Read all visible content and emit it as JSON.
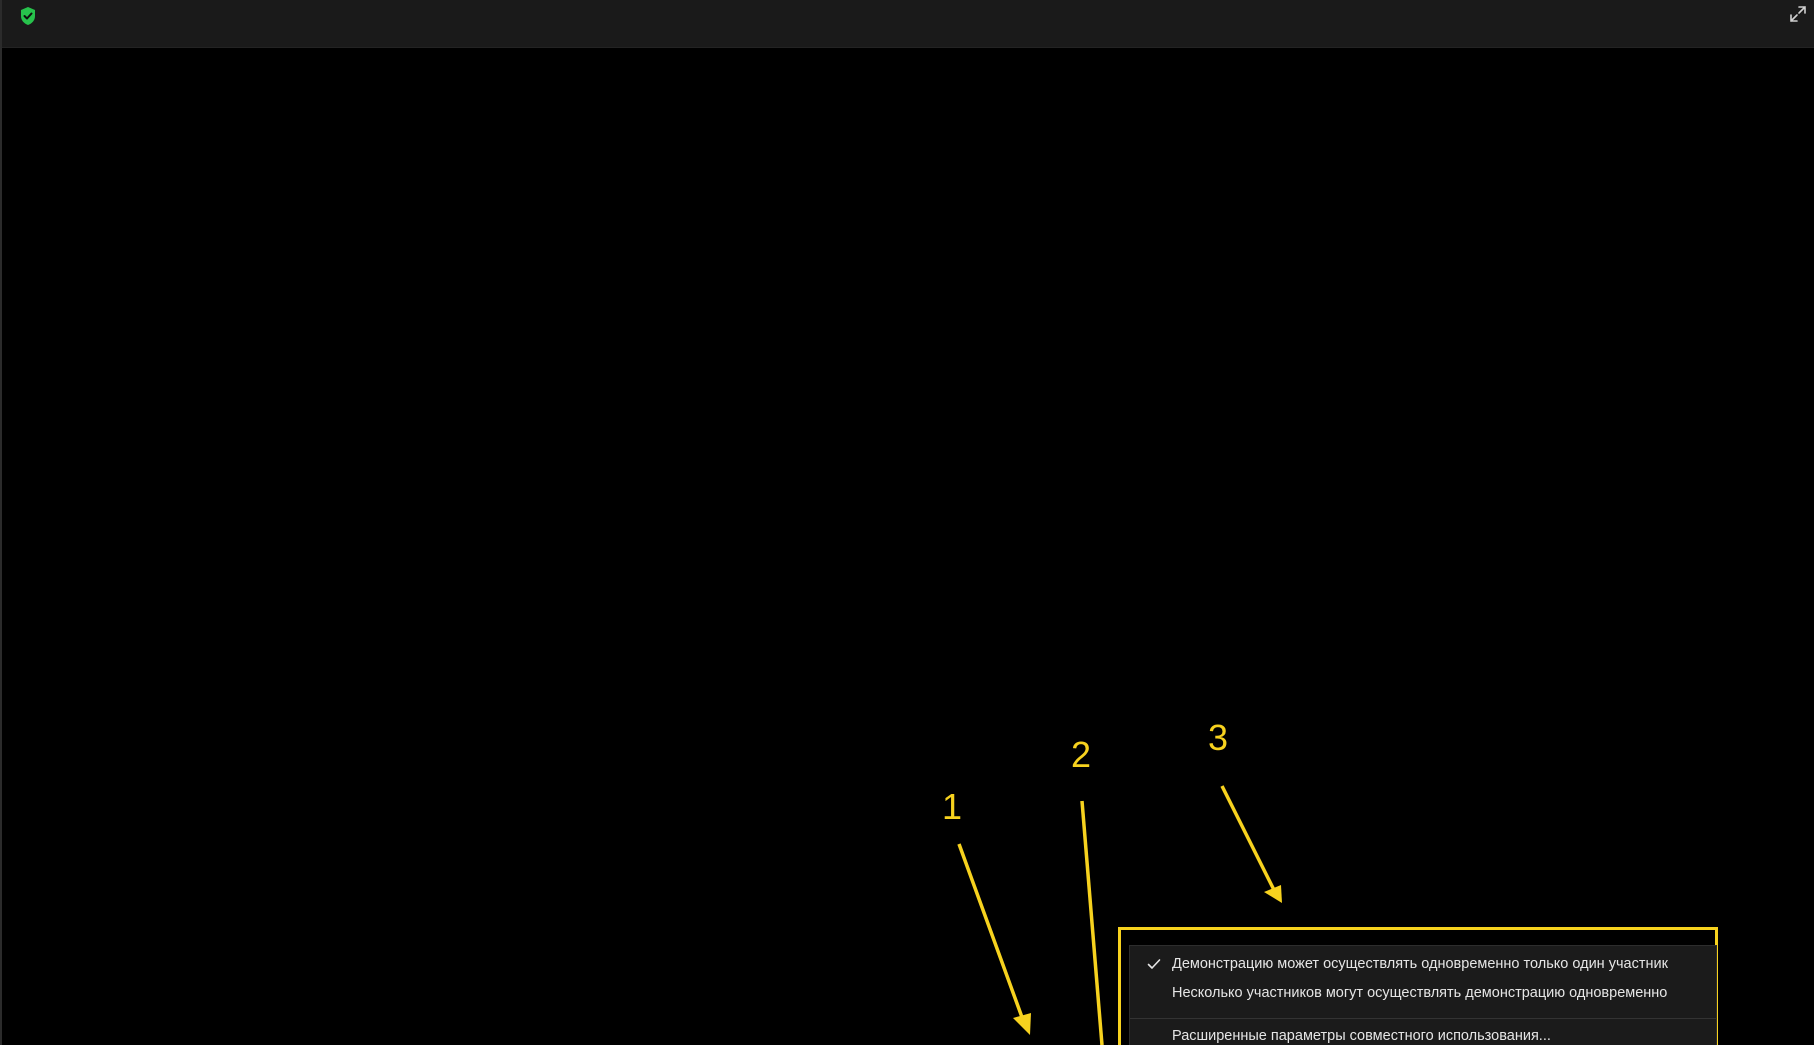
{
  "topbar": {
    "security_icon": "shield-check-icon",
    "security_color": "#27c24c",
    "fullscreen_icon": "expand-diagonal-icon"
  },
  "annotations": {
    "color": "#f7d21e",
    "labels": [
      "1",
      "2",
      "3"
    ]
  },
  "share_menu": {
    "items": [
      {
        "label": "Демонстрацию может осуществлять одновременно только один участник",
        "checked": true
      },
      {
        "label": "Несколько участников могут осуществлять демонстрацию одновременно",
        "checked": false
      },
      {
        "label": "Расширенные параметры совместного использования...",
        "checked": false
      }
    ]
  }
}
